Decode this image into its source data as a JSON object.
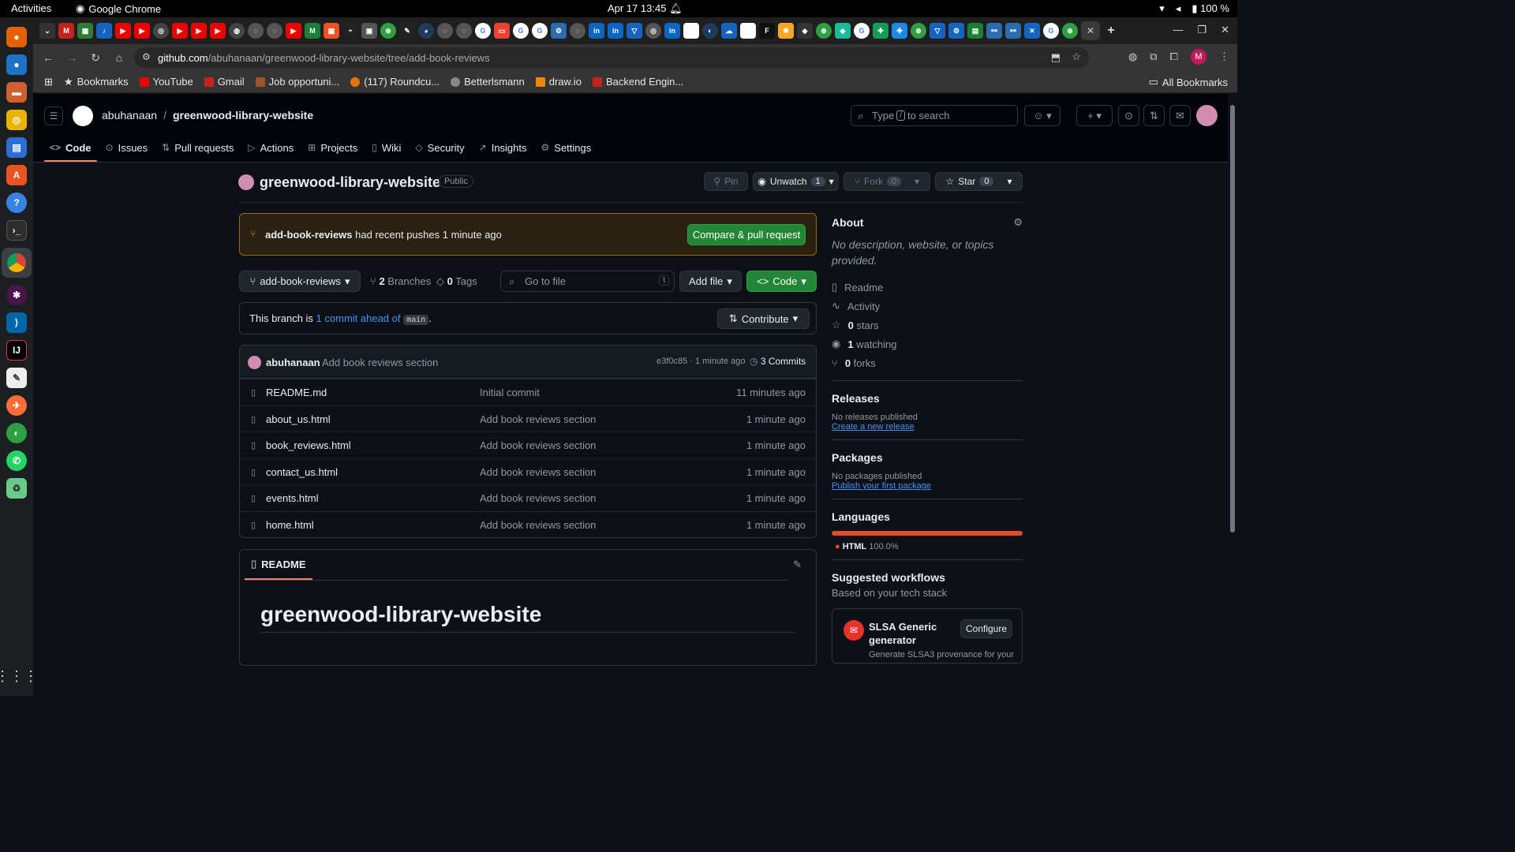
{
  "os": {
    "activities": "Activities",
    "app_name": "Google Chrome",
    "clock": "Apr 17  13:45",
    "battery": "100 %"
  },
  "browser": {
    "url_host": "github.com",
    "url_path": "/abuhanaan/greenwood-library-website/tree/add-book-reviews",
    "profile_initial": "M",
    "bookmarks": [
      "Bookmarks",
      "YouTube",
      "Gmail",
      "Job opportuni...",
      "(117) Roundcu...",
      "Betterlsmann",
      "draw.io",
      "Backend Engin..."
    ],
    "all_bookmarks": "All Bookmarks"
  },
  "github": {
    "owner": "abuhanaan",
    "repo": "greenwood-library-website",
    "search_placeholder_pre": "Type",
    "search_key": "/",
    "search_placeholder_post": "to search",
    "nav": [
      "Code",
      "Issues",
      "Pull requests",
      "Actions",
      "Projects",
      "Wiki",
      "Security",
      "Insights",
      "Settings"
    ],
    "visibility": "Public",
    "pin": "Pin",
    "unwatch": "Unwatch",
    "watch_count": "1",
    "fork": "Fork",
    "fork_count": "0",
    "star": "Star",
    "star_count": "0"
  },
  "banner": {
    "branch": "add-book-reviews",
    "text": "had recent pushes 1 minute ago",
    "button": "Compare & pull request"
  },
  "branch_bar": {
    "current_branch": "add-book-reviews",
    "branches_count": "2",
    "branches_label": "Branches",
    "tags_count": "0",
    "tags_label": "Tags",
    "go_to_file": "Go to file",
    "go_to_file_key": "t",
    "add_file": "Add file",
    "code": "Code"
  },
  "ahead": {
    "prefix": "This branch is",
    "link": "1 commit ahead of",
    "base": "main",
    "suffix": ".",
    "contribute": "Contribute"
  },
  "latest_commit": {
    "author": "abuhanaan",
    "message": "Add book reviews section",
    "hash_time": "e3f0c85 · 1 minute ago",
    "commits": "3 Commits"
  },
  "files": [
    {
      "name": "README.md",
      "message": "Initial commit",
      "time": "11 minutes ago"
    },
    {
      "name": "about_us.html",
      "message": "Add book reviews section",
      "time": "1 minute ago"
    },
    {
      "name": "book_reviews.html",
      "message": "Add book reviews section",
      "time": "1 minute ago"
    },
    {
      "name": "contact_us.html",
      "message": "Add book reviews section",
      "time": "1 minute ago"
    },
    {
      "name": "events.html",
      "message": "Add book reviews section",
      "time": "1 minute ago"
    },
    {
      "name": "home.html",
      "message": "Add book reviews section",
      "time": "1 minute ago"
    }
  ],
  "readme": {
    "tab": "README",
    "heading": "greenwood-library-website"
  },
  "sidebar": {
    "about": "About",
    "description": "No description, website, or topics provided.",
    "readme": "Readme",
    "activity": "Activity",
    "stars_count": "0",
    "stars": "stars",
    "watching_count": "1",
    "watching": "watching",
    "forks_count": "0",
    "forks": "forks",
    "releases": "Releases",
    "no_releases": "No releases published",
    "create_release": "Create a new release",
    "packages": "Packages",
    "no_packages": "No packages published",
    "publish_package": "Publish your first package",
    "languages": "Languages",
    "lang_name": "HTML",
    "lang_pct": "100.0%",
    "lang_color": "#e34c26",
    "suggested": "Suggested workflows",
    "suggested_sub": "Based on your tech stack",
    "wf_name": "SLSA Generic generator",
    "wf_button": "Configure",
    "wf_desc": "Generate SLSA3 provenance for your"
  }
}
